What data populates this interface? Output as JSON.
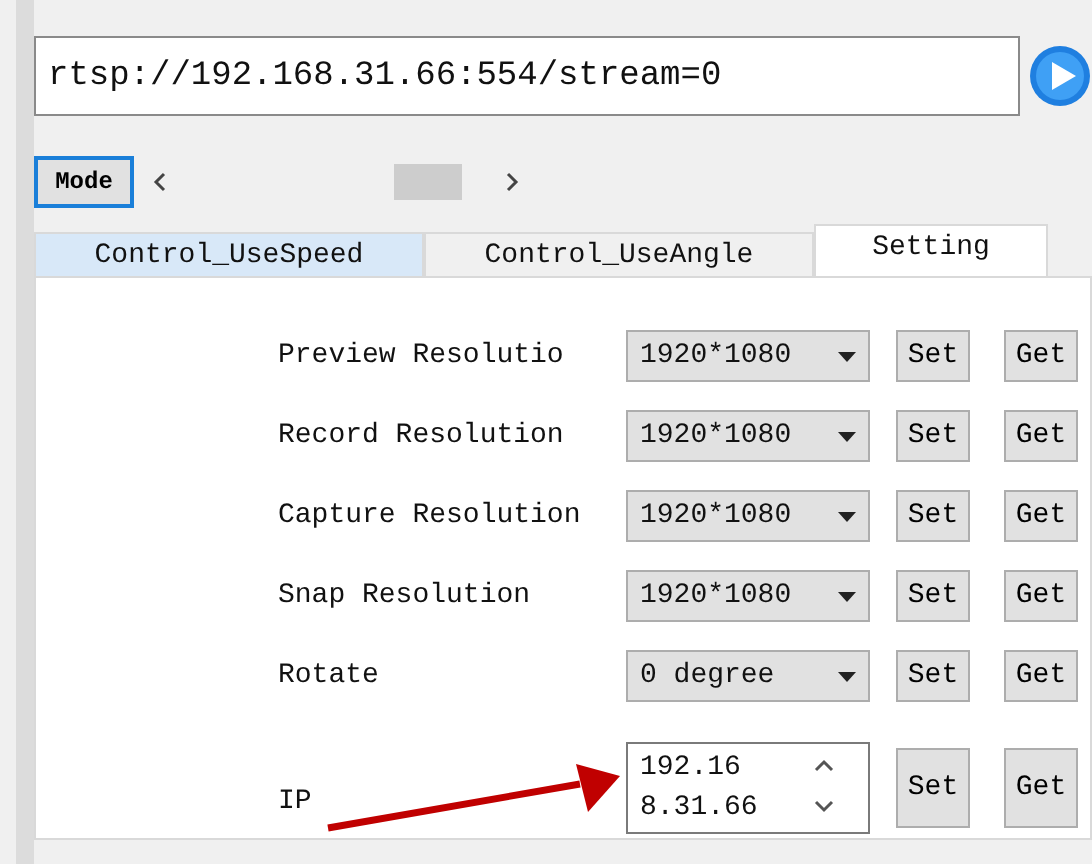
{
  "url_field": {
    "value": "rtsp://192.168.31.66:554/stream=0"
  },
  "mode_button": "Mode",
  "tabs": [
    {
      "label": "Control_UseSpeed",
      "selected": false,
      "highlighted": true
    },
    {
      "label": "Control_UseAngle",
      "selected": false,
      "highlighted": false
    },
    {
      "label": "Setting",
      "selected": true,
      "highlighted": false
    }
  ],
  "rows": [
    {
      "label": "Preview Resolutio",
      "kind": "dropdown",
      "value": "1920*1080",
      "buttons": [
        "Set",
        "Get"
      ]
    },
    {
      "label": "Record Resolution",
      "kind": "dropdown",
      "value": "1920*1080",
      "buttons": [
        "Set",
        "Get"
      ]
    },
    {
      "label": "Capture Resolution",
      "kind": "dropdown",
      "value": "1920*1080",
      "buttons": [
        "Set",
        "Get"
      ]
    },
    {
      "label": "Snap Resolution",
      "kind": "dropdown",
      "value": "1920*1080",
      "buttons": [
        "Set",
        "Get"
      ]
    },
    {
      "label": "Rotate",
      "kind": "dropdown",
      "value": "0 degree",
      "buttons": [
        "Set",
        "Get"
      ]
    },
    {
      "label": "IP",
      "kind": "spin",
      "value": "192.168.31.66",
      "buttons": [
        "Set",
        "Get"
      ]
    }
  ]
}
